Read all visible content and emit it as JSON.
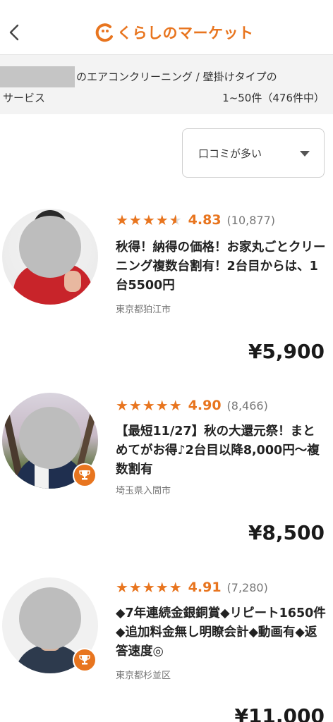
{
  "header": {
    "logo_text": "くらしのマーケット"
  },
  "info_bar": {
    "query_line1": "のエアコンクリーニング / 壁掛けタイプの",
    "query_line2": "サービス",
    "result_count": "1~50件（476件中）"
  },
  "sort": {
    "selected": "口コミが多い"
  },
  "colors": {
    "accent": "#e8751f",
    "info_bar_bg": "#f3f3f3"
  },
  "listings": [
    {
      "stars": "★★★★",
      "score": "4.83",
      "reviews": "(10,877)",
      "title": "秋得！納得の価格！お家丸ごとクリーニング複数台割有！2台目からは、1台5500円",
      "location": "東京都狛江市",
      "price": "¥5,900",
      "has_trophy": false
    },
    {
      "stars": "★★★★★",
      "score": "4.90",
      "reviews": "(8,466)",
      "title": "【最短11/27】秋の大還元祭！まとめてがお得♪2台目以降8,000円〜複数割有",
      "location": "埼玉県入間市",
      "price": "¥8,500",
      "has_trophy": true
    },
    {
      "stars": "★★★★★",
      "score": "4.91",
      "reviews": "(7,280)",
      "title": "◆7年連続金銀銅賞◆リピート1650件◆追加料金無し明瞭会計◆動画有◆返答速度◎",
      "location": "東京都杉並区",
      "price": "¥11,000",
      "has_trophy": true
    }
  ]
}
